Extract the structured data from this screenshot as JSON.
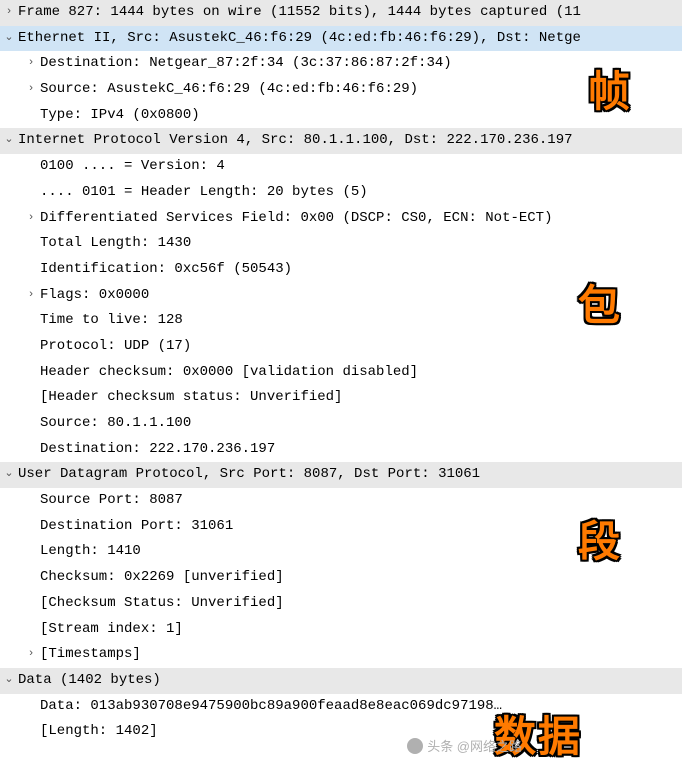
{
  "frame": {
    "header": "Frame 827: 1444 bytes on wire (11552 bits), 1444 bytes captured (11"
  },
  "ethernet": {
    "header": "Ethernet II, Src: AsustekC_46:f6:29 (4c:ed:fb:46:f6:29), Dst: Netge",
    "destination": "Destination: Netgear_87:2f:34 (3c:37:86:87:2f:34)",
    "source": "Source: AsustekC_46:f6:29 (4c:ed:fb:46:f6:29)",
    "type": "Type: IPv4 (0x0800)"
  },
  "ip": {
    "header": "Internet Protocol Version 4, Src: 80.1.1.100, Dst: 222.170.236.197",
    "version": "0100 .... = Version: 4",
    "header_length": ".... 0101 = Header Length: 20 bytes (5)",
    "dsf": "Differentiated Services Field: 0x00 (DSCP: CS0, ECN: Not-ECT)",
    "total_length": "Total Length: 1430",
    "identification": "Identification: 0xc56f (50543)",
    "flags": "Flags: 0x0000",
    "ttl": "Time to live: 128",
    "protocol": "Protocol: UDP (17)",
    "header_checksum": "Header checksum: 0x0000 [validation disabled]",
    "checksum_status": "[Header checksum status: Unverified]",
    "source": "Source: 80.1.1.100",
    "destination": "Destination: 222.170.236.197"
  },
  "udp": {
    "header": "User Datagram Protocol, Src Port: 8087, Dst Port: 31061",
    "src_port": "Source Port: 8087",
    "dst_port": "Destination Port: 31061",
    "length": "Length: 1410",
    "checksum": "Checksum: 0x2269 [unverified]",
    "checksum_status": "[Checksum Status: Unverified]",
    "stream_index": "[Stream index: 1]",
    "timestamps": "[Timestamps]"
  },
  "data": {
    "header": "Data (1402 bytes)",
    "data_line": "Data: 013ab930708e9475900bc89a900feaad8e8eac069dc97198…",
    "length": "[Length: 1402]"
  },
  "annotations": {
    "frame": "帧",
    "packet": "包",
    "segment": "段",
    "data": "数据"
  },
  "watermark": "头条 @网络之路",
  "expander_open": "⌄",
  "expander_closed": "›"
}
